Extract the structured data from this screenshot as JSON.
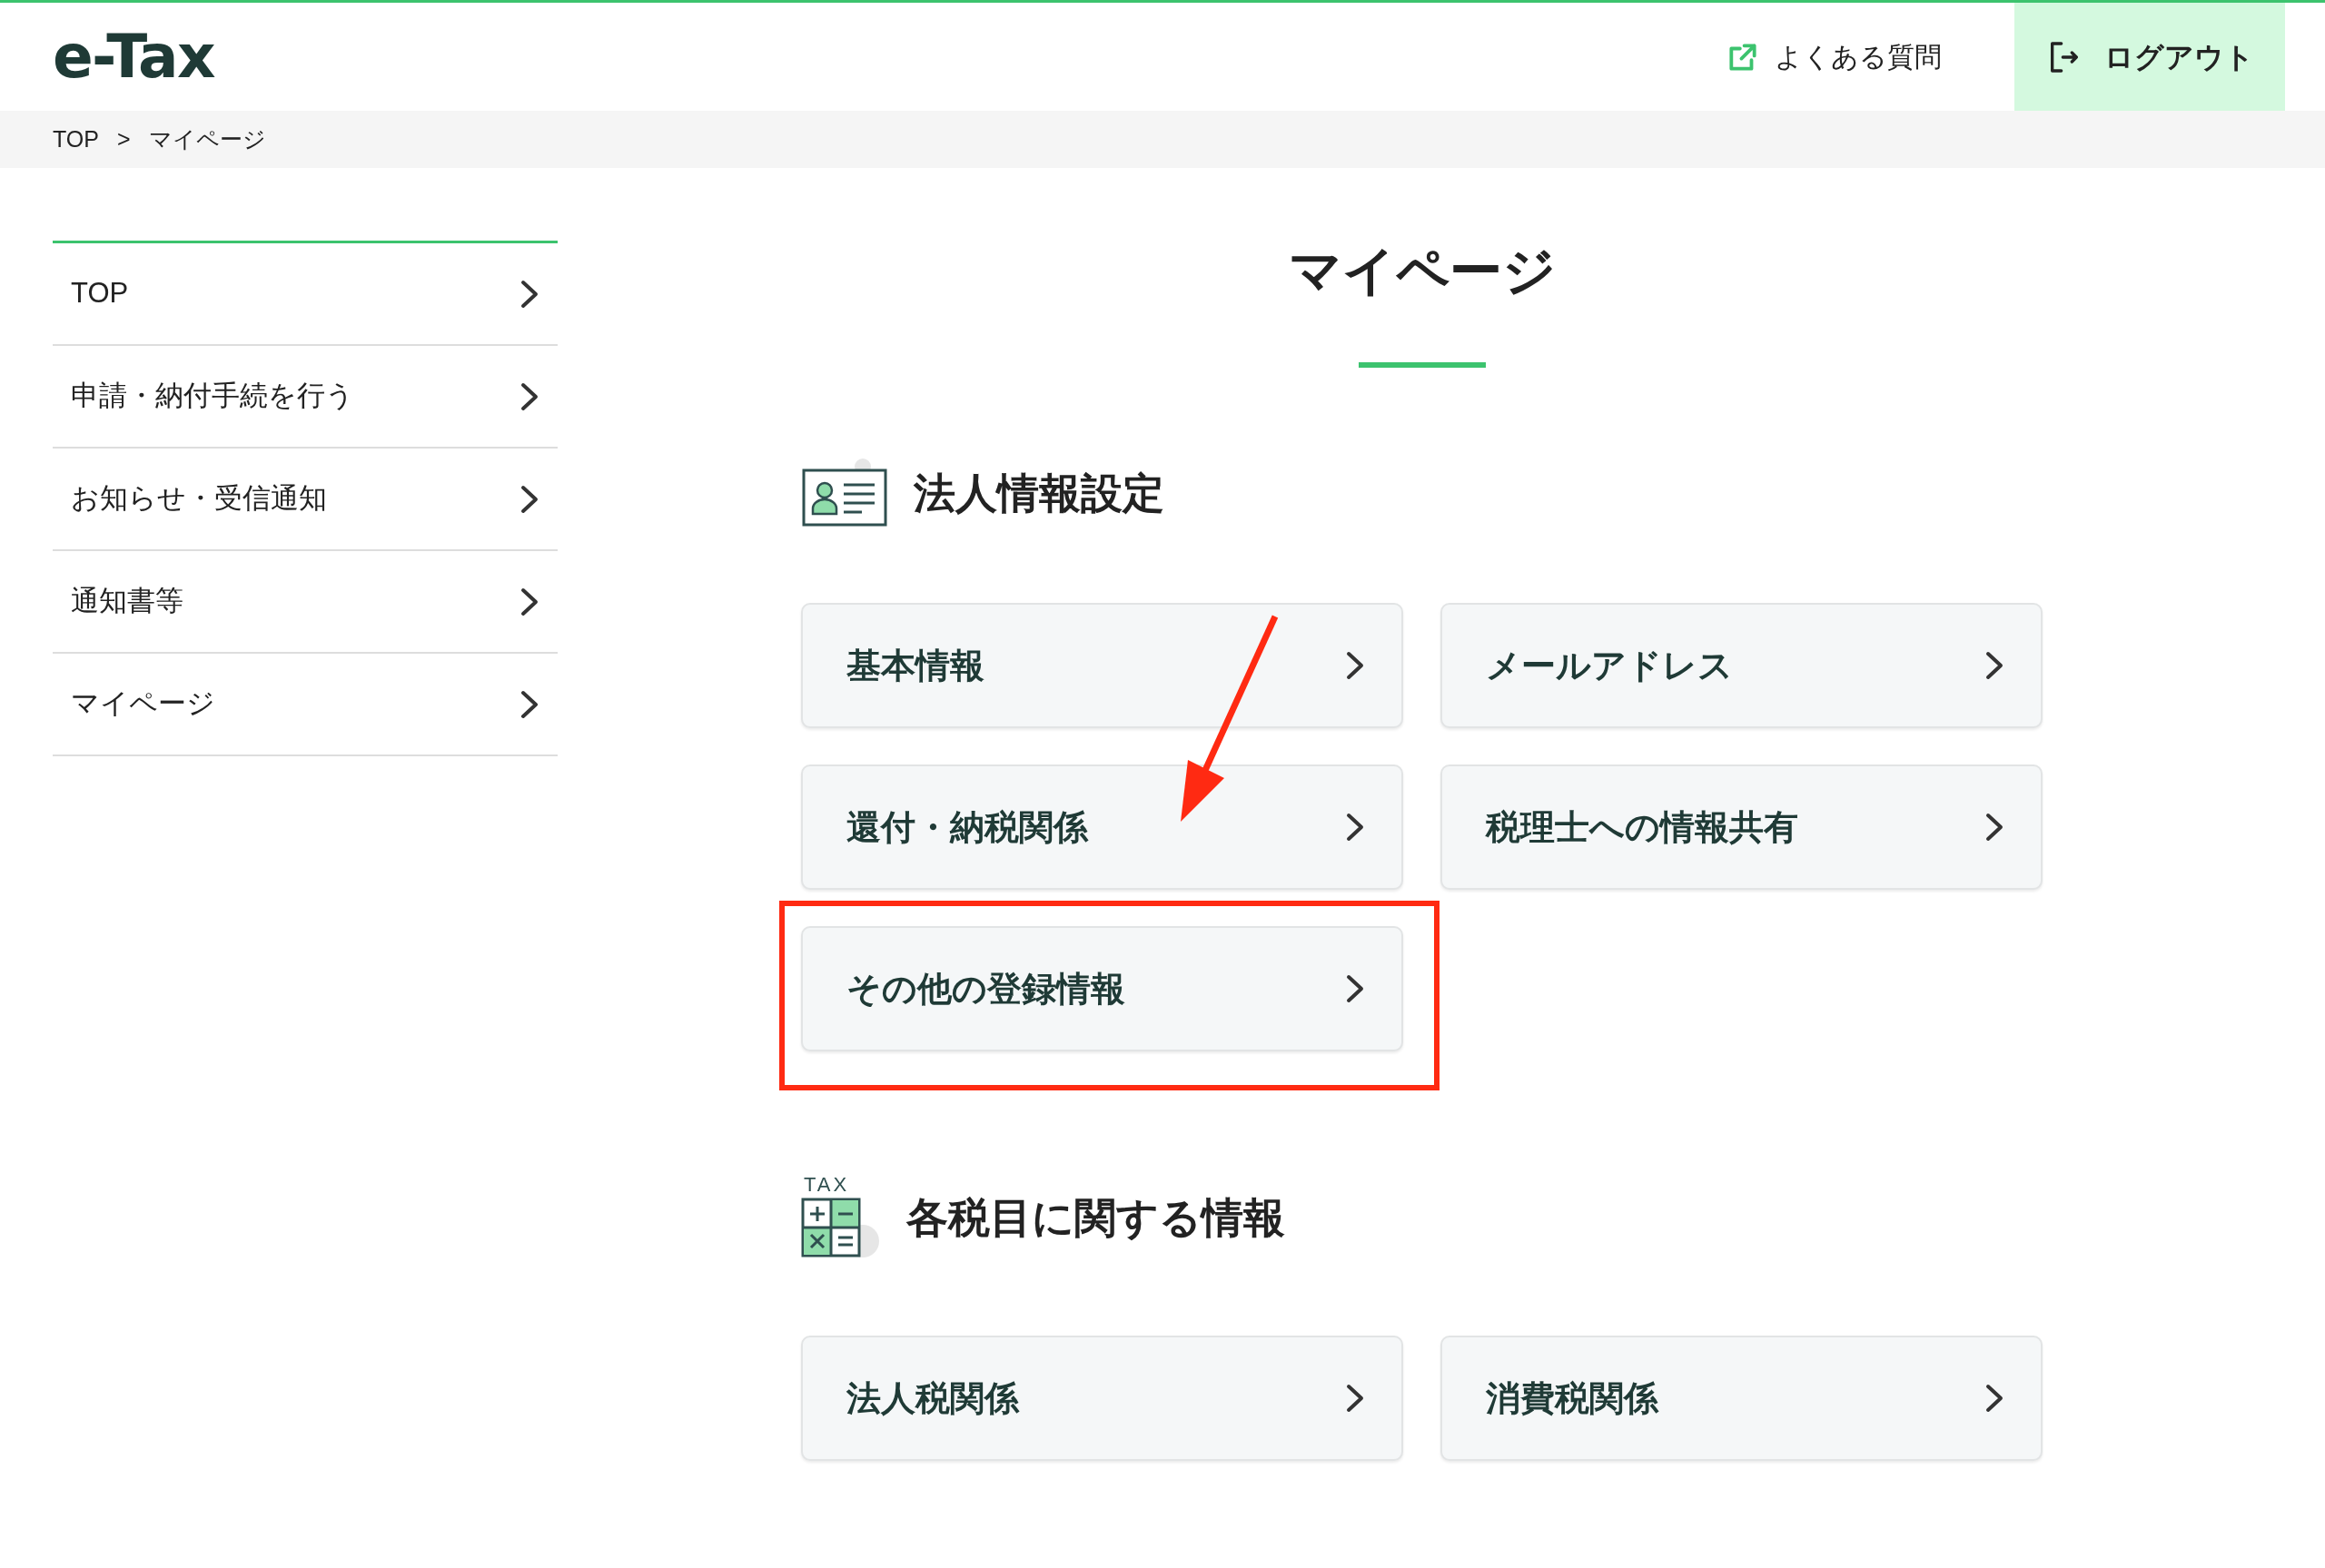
{
  "header": {
    "logo": "e-Tax",
    "faq_link": "よくある質問",
    "logout_button": "ログアウト"
  },
  "breadcrumb": [
    {
      "label": "TOP"
    },
    {
      "label": "マイページ"
    }
  ],
  "breadcrumb_separator": ">",
  "sidebar": {
    "items": [
      {
        "label": "TOP"
      },
      {
        "label": "申請・納付手続を行う"
      },
      {
        "label": "お知らせ・受信通知"
      },
      {
        "label": "通知書等"
      },
      {
        "label": "マイページ"
      }
    ]
  },
  "page_title": "マイページ",
  "sections": [
    {
      "title": "法人情報設定",
      "kind": "id-card",
      "cards": [
        {
          "label": "基本情報",
          "highlighted": false,
          "arrow": false
        },
        {
          "label": "メールアドレス",
          "highlighted": false,
          "arrow": false
        },
        {
          "label": "還付・納税関係",
          "highlighted": false,
          "arrow": true
        },
        {
          "label": "税理士への情報共有",
          "highlighted": false,
          "arrow": false
        },
        {
          "label": "その他の登録情報",
          "highlighted": true,
          "arrow": false
        }
      ]
    },
    {
      "title": "各税目に関する情報",
      "kind": "calculator",
      "icon_label": "TAX",
      "cards": [
        {
          "label": "法人税関係",
          "highlighted": false,
          "arrow": false
        },
        {
          "label": "消費税関係",
          "highlighted": false,
          "arrow": false
        }
      ]
    }
  ]
}
